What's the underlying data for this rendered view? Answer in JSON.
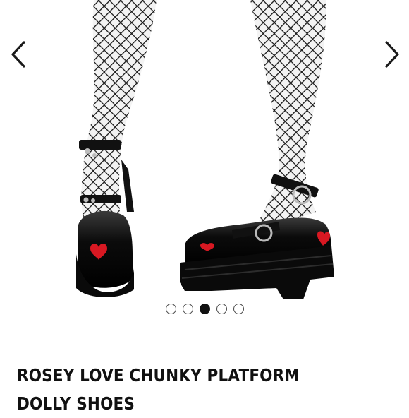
{
  "product": {
    "title": "ROSEY LOVE CHUNKY PLATFORM DOLLY SHOES"
  },
  "carousel": {
    "prev_icon": "chevron-left-icon",
    "next_icon": "chevron-right-icon",
    "slide_count": 5,
    "active_slide": 3
  }
}
